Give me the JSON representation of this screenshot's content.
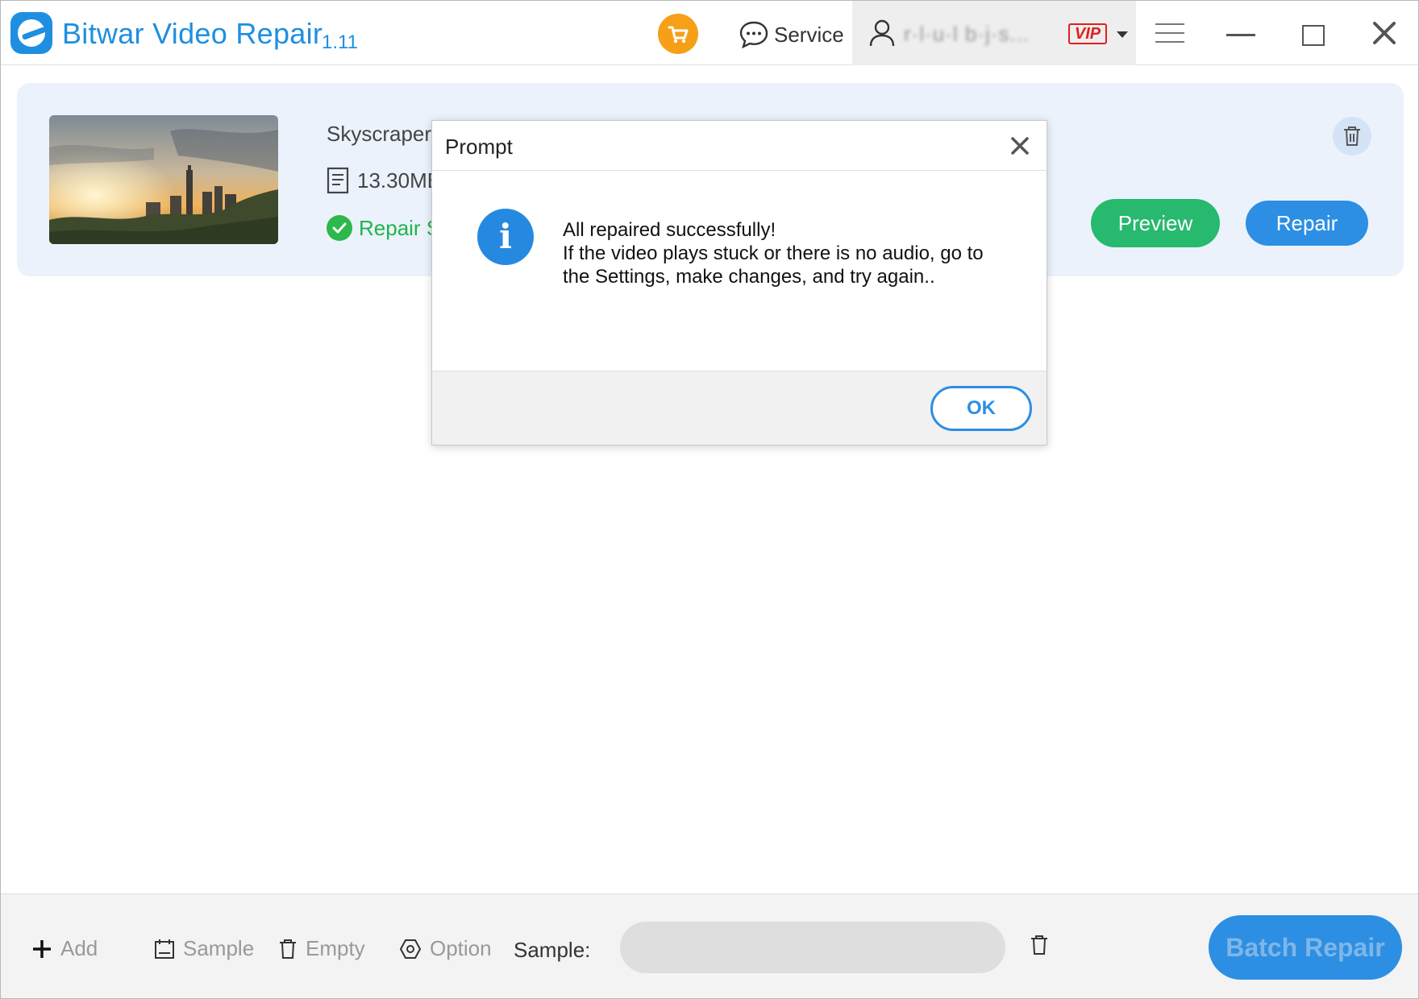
{
  "app": {
    "title": "Bitwar Video Repair",
    "version": "1.11"
  },
  "header": {
    "service_label": "Service",
    "user_name": "r·l·u·l b·j·s...",
    "vip_label": "VIP"
  },
  "file": {
    "name": "Skyscrapers.",
    "size": "13.30MB",
    "status": "Repair Su",
    "preview_label": "Preview",
    "repair_label": "Repair"
  },
  "dialog": {
    "title": "Prompt",
    "line1": "All repaired successfully!",
    "line2": "If the video plays stuck or there is no audio, go to the Settings, make changes, and try again..",
    "ok_label": "OK"
  },
  "toolbar": {
    "add_label": "Add",
    "sample_label": "Sample",
    "empty_label": "Empty",
    "option_label": "Option",
    "sample_field_label": "Sample:",
    "batch_repair_label": "Batch Repair"
  },
  "colors": {
    "brand_blue": "#1e8fe0",
    "accent_orange": "#f5a016",
    "success_green": "#27b96e",
    "vip_red": "#e02020"
  }
}
